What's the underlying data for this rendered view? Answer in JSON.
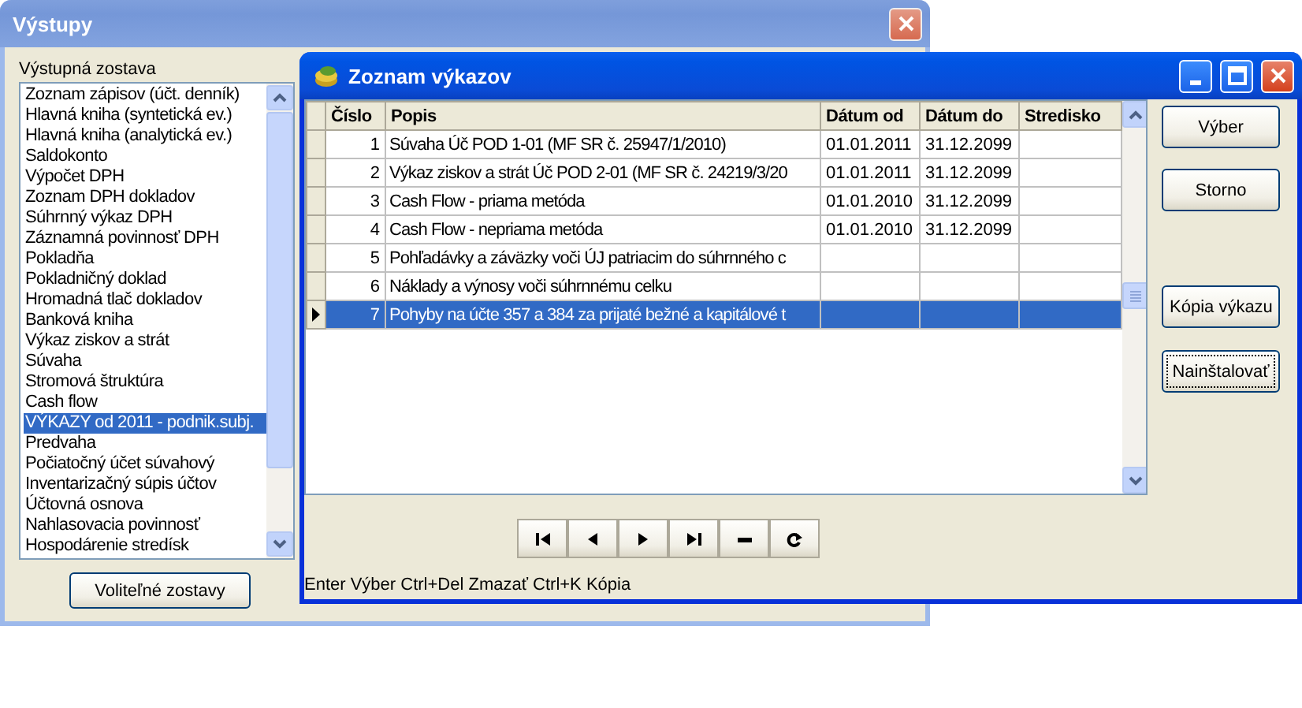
{
  "output_window": {
    "title": "Výstupy",
    "active": false,
    "list_label": "Výstupná zostava",
    "items": [
      {
        "label": "Zoznam zápisov (účt. denník)",
        "selected": false
      },
      {
        "label": "Hlavná kniha (syntetická ev.)",
        "selected": false
      },
      {
        "label": "Hlavná kniha (analytická ev.)",
        "selected": false
      },
      {
        "label": "Saldokonto",
        "selected": false
      },
      {
        "label": "Výpočet DPH",
        "selected": false
      },
      {
        "label": "Zoznam DPH dokladov",
        "selected": false
      },
      {
        "label": "Súhrnný výkaz DPH",
        "selected": false
      },
      {
        "label": "Záznamná povinnosť DPH",
        "selected": false
      },
      {
        "label": "Pokladňa",
        "selected": false
      },
      {
        "label": "Pokladničný doklad",
        "selected": false
      },
      {
        "label": "Hromadná tlač dokladov",
        "selected": false
      },
      {
        "label": "Banková kniha",
        "selected": false
      },
      {
        "label": "Výkaz ziskov a strát",
        "selected": false
      },
      {
        "label": "Súvaha",
        "selected": false
      },
      {
        "label": "Stromová štruktúra",
        "selected": false
      },
      {
        "label": "Cash flow",
        "selected": false
      },
      {
        "label": "VÝKAZY od 2011 - podnik.subj.",
        "selected": true
      },
      {
        "label": "Predvaha",
        "selected": false
      },
      {
        "label": "Počiatočný účet súvahový",
        "selected": false
      },
      {
        "label": "Inventarizačný súpis účtov",
        "selected": false
      },
      {
        "label": "Účtovná osnova",
        "selected": false
      },
      {
        "label": "Nahlasovacia povinnosť",
        "selected": false
      },
      {
        "label": "Hospodárenie stredísk",
        "selected": false
      }
    ],
    "button": "Voliteľné zostavy"
  },
  "reports_window": {
    "title": "Zoznam výkazov",
    "active": true,
    "columns": [
      "Číslo",
      "Popis",
      "Dátum od",
      "Dátum do",
      "Stredisko"
    ],
    "rows": [
      {
        "number": "1",
        "description": "Súvaha Úč POD 1-01 (MF SR č. 25947/1/2010)",
        "date_from": "01.01.2011",
        "date_to": "31.12.2099",
        "selected": false
      },
      {
        "number": "2",
        "description": "Výkaz ziskov a strát Úč POD 2-01 (MF SR č. 24219/3/20",
        "date_from": "01.01.2011",
        "date_to": "31.12.2099",
        "selected": false
      },
      {
        "number": "3",
        "description": "Cash Flow - priama metóda",
        "date_from": "01.01.2010",
        "date_to": "31.12.2099",
        "selected": false
      },
      {
        "number": "4",
        "description": "Cash Flow - nepriama metóda",
        "date_from": "01.01.2010",
        "date_to": "31.12.2099",
        "selected": false
      },
      {
        "number": "5",
        "description": "Pohľadávky a záväzky voči ÚJ patriacim do súhrnného c",
        "selected": false
      },
      {
        "number": "6",
        "description": "Náklady a výnosy voči súhrnnému celku",
        "selected": false
      },
      {
        "number": "7",
        "description": "Pohyby na účte 357 a 384 za prijaté bežné a kapitálové t",
        "selected": true
      }
    ],
    "buttons": [
      {
        "label": "Výber",
        "focused": false
      },
      {
        "label": "Storno",
        "focused": false
      },
      {
        "label": "Kópia výkazu",
        "focused": false
      },
      {
        "label": "Nainštalovať",
        "focused": true
      }
    ],
    "status_bar": "Enter Výber  Ctrl+Del Zmazať  Ctrl+K Kópia"
  }
}
